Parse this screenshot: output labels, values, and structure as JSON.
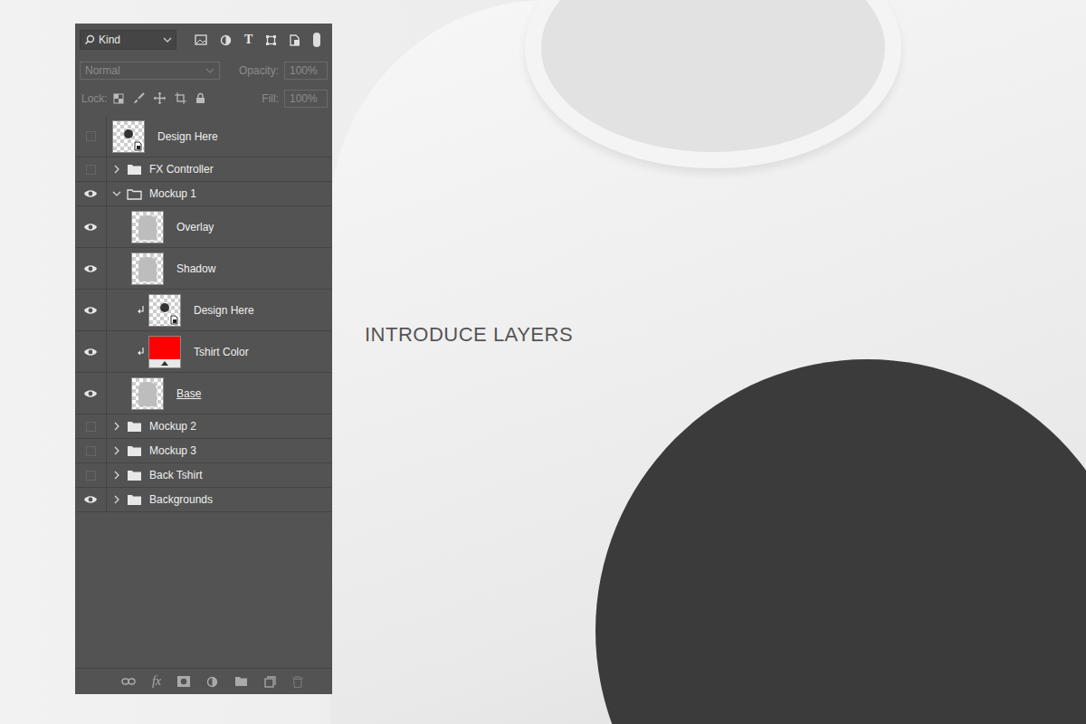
{
  "caption": "INTRODUCE LAYERS",
  "panel": {
    "filter": {
      "label": "Kind",
      "type_glyph": "T"
    },
    "blend": {
      "value": "Normal",
      "disabled": true
    },
    "opacity": {
      "label": "Opacity:",
      "value": "100%",
      "disabled": true
    },
    "lock": {
      "label": "Lock:"
    },
    "fill": {
      "label": "Fill:",
      "value": "100%",
      "disabled": true
    },
    "layers": [
      {
        "name": "Design Here",
        "kind": "smart",
        "visible": false,
        "nested": false,
        "clipped": false,
        "clip_base": false
      },
      {
        "name": "FX Controller",
        "kind": "group",
        "visible": false,
        "nested": false,
        "expanded": false
      },
      {
        "name": "Mockup 1",
        "kind": "group",
        "visible": true,
        "nested": false,
        "expanded": true
      },
      {
        "name": "Overlay",
        "kind": "pixel",
        "visible": true,
        "nested": true,
        "clipped": false,
        "clip_base": false
      },
      {
        "name": "Shadow",
        "kind": "pixel",
        "visible": true,
        "nested": true,
        "clipped": false,
        "clip_base": false
      },
      {
        "name": "Design Here",
        "kind": "smart",
        "visible": true,
        "nested": true,
        "clipped": true,
        "clip_base": false
      },
      {
        "name": "Tshirt Color",
        "kind": "fill",
        "visible": true,
        "nested": true,
        "clipped": true,
        "clip_base": false,
        "color": "#ff0000"
      },
      {
        "name": "Base",
        "kind": "pixel",
        "visible": true,
        "nested": true,
        "clipped": false,
        "clip_base": true
      },
      {
        "name": "Mockup 2",
        "kind": "group",
        "visible": false,
        "nested": false,
        "expanded": false
      },
      {
        "name": "Mockup 3",
        "kind": "group",
        "visible": false,
        "nested": false,
        "expanded": false
      },
      {
        "name": "Back Tshirt",
        "kind": "group",
        "visible": false,
        "nested": false,
        "expanded": false
      },
      {
        "name": "Backgrounds",
        "kind": "group",
        "visible": true,
        "nested": false,
        "expanded": false
      }
    ],
    "toolbar": {
      "fx_glyph": "fx"
    }
  }
}
